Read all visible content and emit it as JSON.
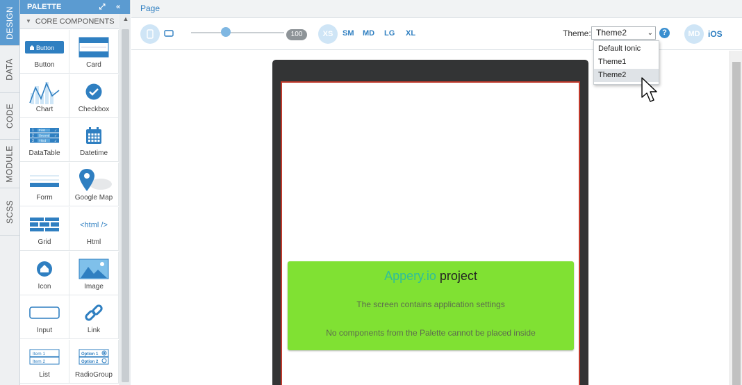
{
  "side_tabs": [
    "DESIGN",
    "DATA",
    "CODE",
    "MODULE",
    "SCSS"
  ],
  "palette": {
    "title": "PALETTE",
    "section": "CORE COMPONENTS",
    "items": [
      {
        "label": "Button",
        "icon": "button-icon"
      },
      {
        "label": "Card",
        "icon": "card-icon"
      },
      {
        "label": "Chart",
        "icon": "chart-icon"
      },
      {
        "label": "Checkbox",
        "icon": "checkbox-icon"
      },
      {
        "label": "DataTable",
        "icon": "datatable-icon"
      },
      {
        "label": "Datetime",
        "icon": "calendar-icon"
      },
      {
        "label": "Form",
        "icon": "form-icon"
      },
      {
        "label": "Google Map",
        "icon": "map-pin-icon"
      },
      {
        "label": "Grid",
        "icon": "grid-icon"
      },
      {
        "label": "Html",
        "icon": "html-icon"
      },
      {
        "label": "Icon",
        "icon": "home-icon"
      },
      {
        "label": "Image",
        "icon": "image-icon"
      },
      {
        "label": "Input",
        "icon": "input-icon"
      },
      {
        "label": "Link",
        "icon": "link-icon"
      },
      {
        "label": "List",
        "icon": "list-icon"
      },
      {
        "label": "RadioGroup",
        "icon": "radiogroup-icon"
      }
    ],
    "button_icon_text": "Button",
    "html_icon_text": "<html />",
    "datatable_rows": [
      "First",
      "Second",
      "Third"
    ],
    "list_rows": [
      "Item 1",
      "Item 2"
    ],
    "radio_rows": [
      "Option 1",
      "Option 2"
    ]
  },
  "page_tab": "Page",
  "toolbar": {
    "zoom": "100",
    "breakpoints": [
      "XS",
      "SM",
      "MD",
      "LG",
      "XL"
    ],
    "theme_label": "Theme:",
    "theme_selected": "Theme2",
    "theme_options": [
      "Default Ionic",
      "Theme1",
      "Theme2"
    ],
    "help": "?",
    "mode_md": "MD",
    "mode_ios": "iOS"
  },
  "card": {
    "brand": "Appery.io",
    "title_rest": " project",
    "line1": "The screen contains application settings",
    "line2": "No components from the Palette cannot be placed inside"
  },
  "colors": {
    "accent": "#5b9bd1",
    "card_bg": "#80e133",
    "brand": "#2fbf9a",
    "device": "#333435"
  }
}
